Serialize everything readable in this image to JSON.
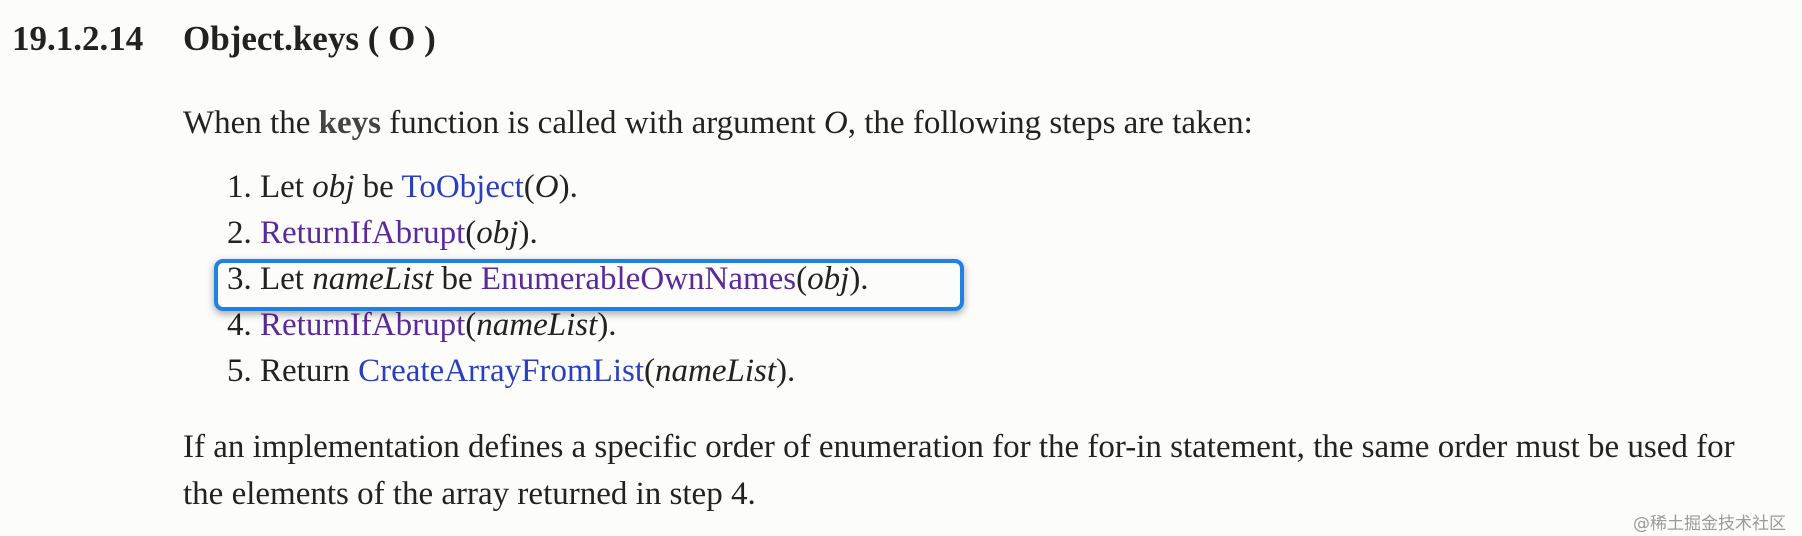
{
  "section": {
    "number": "19.1.2.14",
    "title": "Object.keys ( O )"
  },
  "intro": {
    "part1": "When the ",
    "keyword": "keys",
    "part2": " function is called with argument ",
    "arg": "O",
    "part3": ", the following steps are taken:"
  },
  "steps": [
    {
      "num": "1.",
      "pre": " Let ",
      "var": "obj",
      "mid": " be ",
      "fn": "ToObject",
      "open": "(",
      "argv": "O",
      "close": ")."
    },
    {
      "num": "2.",
      "pre": " ",
      "fn": "ReturnIfAbrupt",
      "open": "(",
      "argv": "obj",
      "close": ")."
    },
    {
      "num": "3.",
      "pre": " Let ",
      "var": "nameList",
      "mid": " be ",
      "fn": "EnumerableOwnNames",
      "open": "(",
      "argv": "obj",
      "close": ")."
    },
    {
      "num": "4.",
      "pre": " ",
      "fn": "ReturnIfAbrupt",
      "open": "(",
      "argv": "nameList",
      "close": ")."
    },
    {
      "num": "5.",
      "pre": " Return ",
      "fn": "CreateArrayFromList",
      "open": "(",
      "argv": "nameList",
      "close": ")."
    }
  ],
  "note": "If an implementation defines a specific order of enumeration for the for-in statement, the same order must be used for the elements of the array returned in step 4.",
  "watermark": "@稀土掘金技术社区",
  "colors": {
    "link_blue": "#2a3fbf",
    "link_purple": "#5a2a9c",
    "highlight_border": "#1f82e0"
  }
}
